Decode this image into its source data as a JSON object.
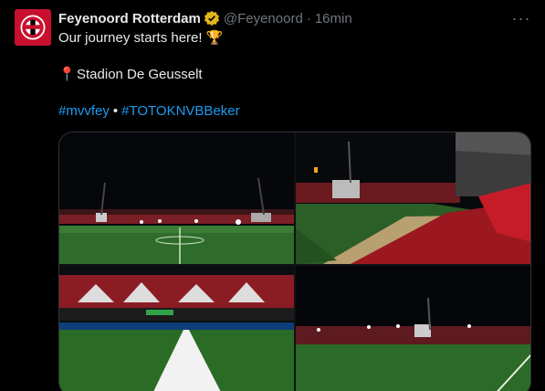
{
  "tweet": {
    "author_name": "Feyenoord Rotterdam",
    "handle": "@Feyenoord",
    "separator": "·",
    "time": "16min",
    "more_label": "···",
    "text_line1": "Our journey starts here! 🏆",
    "location_pin": "📍",
    "location": "Stadion De Geusselt",
    "hashtags": [
      "#mvvfey",
      "#TOTOKNVBBeker"
    ],
    "hashtag_separator": "•"
  },
  "icons": {
    "avatar": "feyenoord-logo",
    "verified": "verified-badge-icon",
    "more": "more-options-icon"
  },
  "colors": {
    "background": "#000000",
    "text": "#e7e9ea",
    "muted": "#71767b",
    "link": "#1d9bf0",
    "verified_gold": "#e2b719",
    "brand_red": "#c8102e"
  },
  "media": {
    "photos": [
      {
        "label": "stadium-wide-night"
      },
      {
        "label": "stands-red-seats"
      },
      {
        "label": "pitch-line-closeup"
      },
      {
        "label": "stadium-pitch-corner"
      }
    ]
  }
}
